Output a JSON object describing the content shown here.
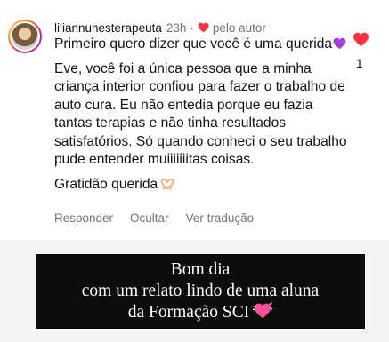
{
  "comment": {
    "username": "liliannunesterapeuta",
    "time": "23h",
    "separator": "·",
    "author_tag": "pelo autor",
    "paragraph1": "Primeiro quero dizer que você é uma querida",
    "paragraph2": "Eve, você foi a única pessoa que a minha criança interior confiou para fazer o trabalho de auto cura. Eu não entedia porque eu fazia tantas terapias e não tinha resultados satisfatórios. Só quando conheci o seu trabalho pude entender muiiiiiiitas coisas.",
    "paragraph3": "Gratidão querida",
    "like_count": "1",
    "icons": {
      "author_heart": "heart-icon",
      "like": "heart-icon",
      "emoji1": "purple-heart-icon",
      "emoji2": "heart-hands-icon"
    }
  },
  "actions": {
    "reply": "Responder",
    "hide": "Ocultar",
    "translate": "Ver tradução"
  },
  "banner": {
    "line1": "Bom dia",
    "line2": "com um relato lindo de uma aluna",
    "line3": "da Formação SCI",
    "emoji": "pink-heart-icon"
  },
  "colors": {
    "heart_red": "#ff3040",
    "muted_text": "#737373",
    "banner_bg": "#0c0c0c",
    "purple_heart": "#a33fe0",
    "pink_heart": "#ff4f9a"
  }
}
